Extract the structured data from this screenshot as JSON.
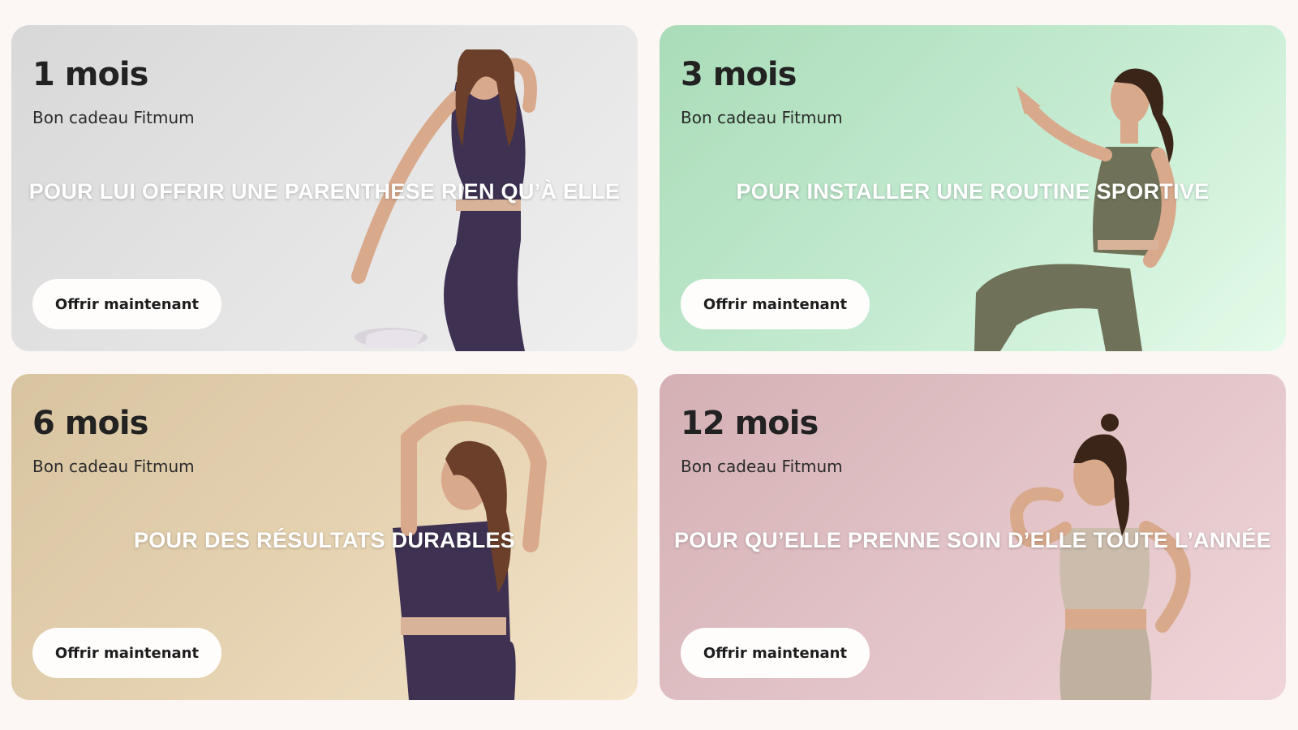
{
  "cards": [
    {
      "duration": "1 mois",
      "subtitle": "Bon cadeau Fitmum",
      "tagline": "POUR LUI OFFRIR UNE PARENTHESE RIEN QU’À ELLE",
      "cta": "Offrir maintenant",
      "outfit_color": "#4a3b5e",
      "background_accent": "#e0e0e0"
    },
    {
      "duration": "3 mois",
      "subtitle": "Bon cadeau Fitmum",
      "tagline": "POUR INSTALLER UNE ROUTINE SPORTIVE",
      "cta": "Offrir maintenant",
      "outfit_color": "#6f7258",
      "background_accent": "#bfe8cb"
    },
    {
      "duration": "6 mois",
      "subtitle": "Bon cadeau Fitmum",
      "tagline": "POUR DES RÉSULTATS DURABLES",
      "cta": "Offrir maintenant",
      "outfit_color": "#4a3b5e",
      "background_accent": "#e7d4b3"
    },
    {
      "duration": "12 mois",
      "subtitle": "Bon cadeau Fitmum",
      "tagline": "POUR QU’ELLE PRENNE SOIN D’ELLE TOUTE L’ANNÉE",
      "cta": "Offrir maintenant",
      "outfit_color": "#cbbcac",
      "background_accent": "#e3c4c8"
    }
  ]
}
